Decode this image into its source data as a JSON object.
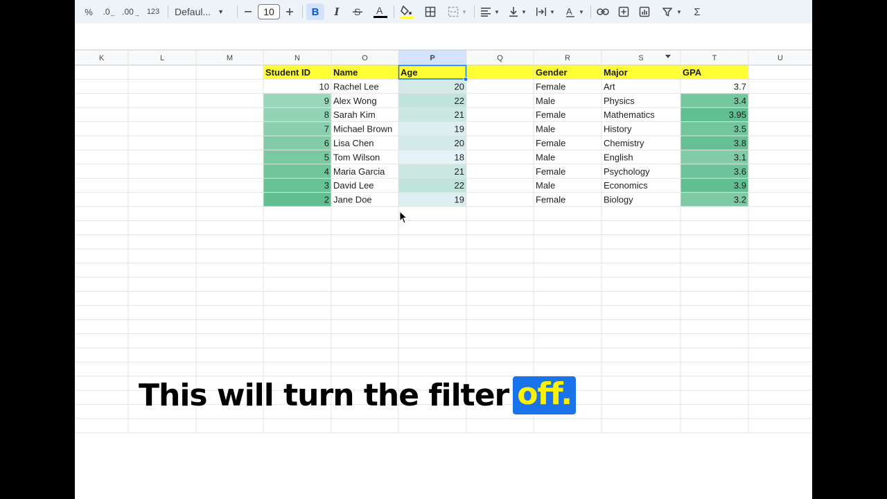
{
  "toolbar": {
    "percent": "%",
    "dec_decrease": ".0",
    "dec_increase": ".00",
    "number_format": "123",
    "font": "Defaul...",
    "font_size": "10",
    "bold": "B",
    "italic": "I",
    "sum": "Σ"
  },
  "columns": [
    "K",
    "L",
    "M",
    "N",
    "O",
    "P",
    "Q",
    "R",
    "S",
    "T",
    "U"
  ],
  "selected_column": "P",
  "header_row": [
    "Student ID",
    "Name",
    "Age",
    "",
    "Gender",
    "Major",
    "GPA"
  ],
  "rows": [
    {
      "id": "10",
      "name": "Rachel Lee",
      "age": "20",
      "gender": "Female",
      "major": "Art",
      "gpa": "3.7"
    },
    {
      "id": "9",
      "name": "Alex Wong",
      "age": "22",
      "gender": "Male",
      "major": "Physics",
      "gpa": "3.4"
    },
    {
      "id": "8",
      "name": "Sarah Kim",
      "age": "21",
      "gender": "Female",
      "major": "Mathematics",
      "gpa": "3.95"
    },
    {
      "id": "7",
      "name": "Michael Brown",
      "age": "19",
      "gender": "Male",
      "major": "History",
      "gpa": "3.5"
    },
    {
      "id": "6",
      "name": "Lisa Chen",
      "age": "20",
      "gender": "Female",
      "major": "Chemistry",
      "gpa": "3.8"
    },
    {
      "id": "5",
      "name": "Tom Wilson",
      "age": "18",
      "gender": "Male",
      "major": "English",
      "gpa": "3.1"
    },
    {
      "id": "4",
      "name": "Maria Garcia",
      "age": "21",
      "gender": "Female",
      "major": "Psychology",
      "gpa": "3.6"
    },
    {
      "id": "3",
      "name": "David Lee",
      "age": "22",
      "gender": "Male",
      "major": "Economics",
      "gpa": "3.9"
    },
    {
      "id": "2",
      "name": "Jane Doe",
      "age": "19",
      "gender": "Female",
      "major": "Biology",
      "gpa": "3.2"
    }
  ],
  "colors": {
    "header_fill": "#ffff33",
    "toolbar_bg": "#eef2f9",
    "selected_header": "#d3e3fd",
    "accent": "#1a73e8",
    "highlight_text": "#fff200"
  },
  "caption": {
    "text": "This will turn the filter",
    "highlight": "off."
  }
}
